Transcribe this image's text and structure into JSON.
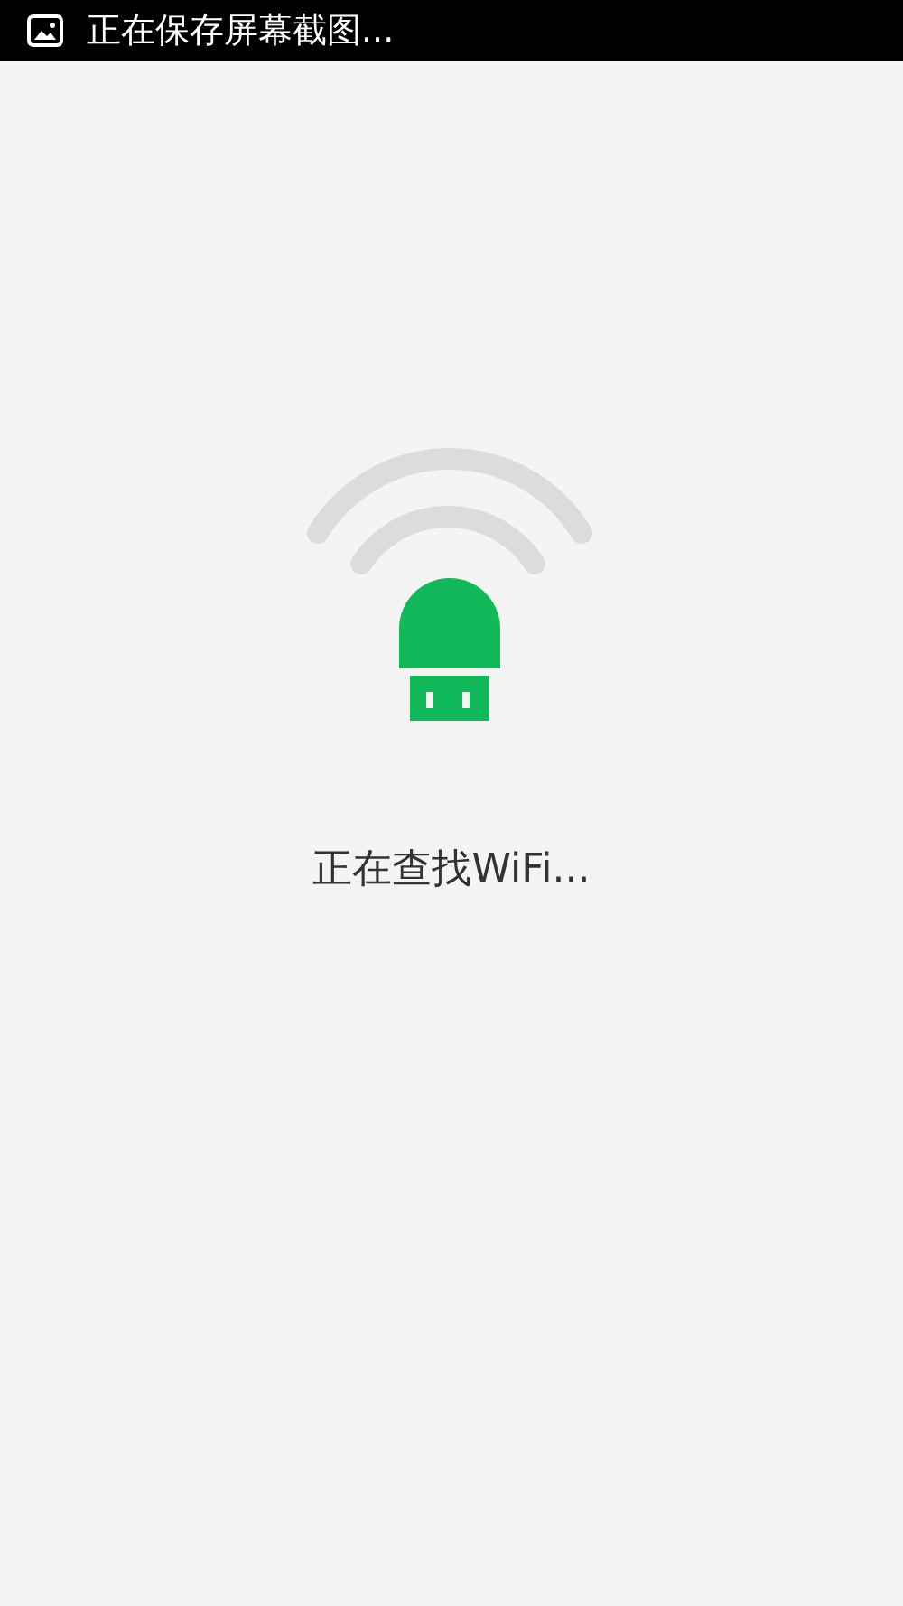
{
  "status_bar": {
    "notification": "正在保存屏幕截图..."
  },
  "message": "正在查找WiFi..."
}
